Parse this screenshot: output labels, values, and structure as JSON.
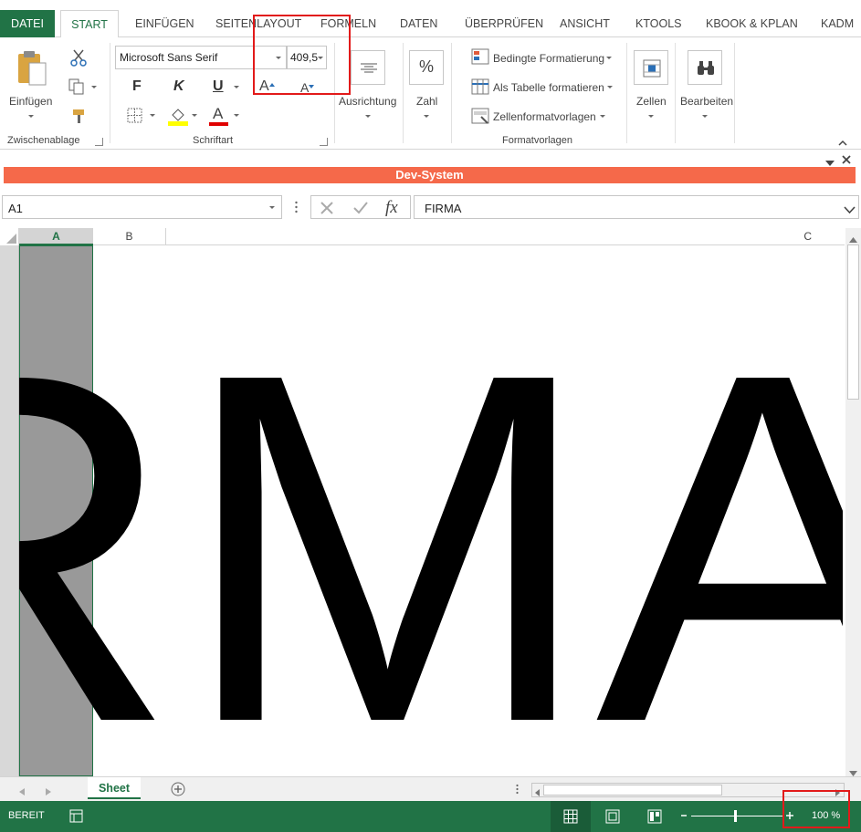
{
  "tabs": {
    "file": "DATEI",
    "items": [
      "START",
      "EINFÜGEN",
      "SEITENLAYOUT",
      "FORMELN",
      "DATEN",
      "ÜBERPRÜFEN",
      "ANSICHT",
      "KTOOLS",
      "KBOOK & KPLAN",
      "KADM"
    ]
  },
  "ribbon": {
    "clipboard": {
      "paste_label": "Einfügen",
      "group_label": "Zwischenablage"
    },
    "font": {
      "font_name": "Microsoft Sans Serif",
      "font_size": "409,5",
      "bold": "F",
      "italic": "K",
      "underline": "U",
      "font_color_letter": "A",
      "grow_letter": "A",
      "shrink_letter": "A",
      "group_label": "Schriftart"
    },
    "alignment": {
      "label": "Ausrichtung"
    },
    "number": {
      "label": "Zahl",
      "symbol": "%"
    },
    "styles": {
      "conditional": "Bedingte Formatierung",
      "as_table": "Als Tabelle formatieren",
      "cell_styles": "Zellenformatvorlagen",
      "group_label": "Formatvorlagen"
    },
    "cells": {
      "label": "Zellen"
    },
    "editing": {
      "label": "Bearbeiten"
    }
  },
  "devbar": {
    "title": "Dev-System"
  },
  "formula_bar": {
    "name_box": "A1",
    "fx": "fx",
    "content": "FIRMA"
  },
  "grid": {
    "columns": [
      "A",
      "B",
      "C"
    ],
    "cell_text": "RMA"
  },
  "sheet_tabs": {
    "active": "Sheet"
  },
  "status": {
    "mode": "BEREIT",
    "zoom": "100 %"
  },
  "colors": {
    "accent": "#217346",
    "dev_bar": "#f5694a",
    "highlight": "#e21a1a"
  }
}
